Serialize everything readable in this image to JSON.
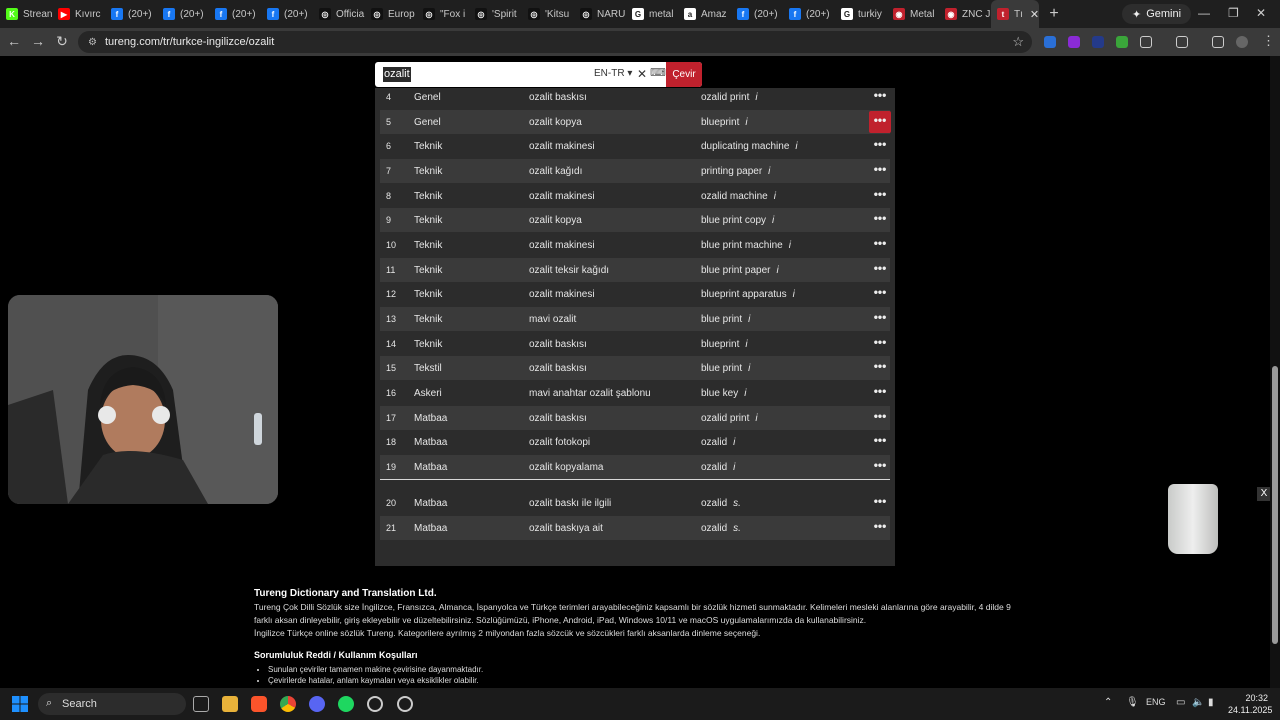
{
  "tabs": [
    {
      "label": "Strean",
      "color": "#53fc18",
      "glyph": "K"
    },
    {
      "label": "Kıvırc",
      "color": "#ff0000",
      "glyph": "▶"
    },
    {
      "label": "(20+)",
      "color": "#1877f2",
      "glyph": "f"
    },
    {
      "label": "(20+)",
      "color": "#1877f2",
      "glyph": "f"
    },
    {
      "label": "(20+)",
      "color": "#1877f2",
      "glyph": "f"
    },
    {
      "label": "(20+)",
      "color": "#1877f2",
      "glyph": "f"
    },
    {
      "label": "Officia",
      "color": "#111111",
      "glyph": "◎"
    },
    {
      "label": "Europ",
      "color": "#111111",
      "glyph": "◎"
    },
    {
      "label": "\"Fox i",
      "color": "#111111",
      "glyph": "◎"
    },
    {
      "label": "'Spirit",
      "color": "#111111",
      "glyph": "◎"
    },
    {
      "label": "'Kitsu",
      "color": "#111111",
      "glyph": "◎"
    },
    {
      "label": "NARU",
      "color": "#111111",
      "glyph": "◎"
    },
    {
      "label": "metal",
      "color": "#ffffff",
      "glyph": "G"
    },
    {
      "label": "Amaz",
      "color": "#ffffff",
      "glyph": "a"
    },
    {
      "label": "(20+)",
      "color": "#1877f2",
      "glyph": "f"
    },
    {
      "label": "(20+)",
      "color": "#1877f2",
      "glyph": "f"
    },
    {
      "label": "turkiy",
      "color": "#ffffff",
      "glyph": "G"
    },
    {
      "label": "Metal",
      "color": "#c0212d",
      "glyph": "◉"
    },
    {
      "label": "ZNC J",
      "color": "#c0212d",
      "glyph": "◉"
    },
    {
      "label": "Tı",
      "color": "#c0212d",
      "glyph": "t"
    }
  ],
  "browser": {
    "gemini_label": "Gemini",
    "url": "tureng.com/tr/turkce-ingilizce/ozalit"
  },
  "search": {
    "value": "ozalit",
    "lang": "EN-TR",
    "button": "Çevir"
  },
  "results": [
    {
      "num": "4",
      "cat": "Genel",
      "tr": "ozalit baskısı",
      "en": "ozalid print",
      "mark": "i"
    },
    {
      "num": "5",
      "cat": "Genel",
      "tr": "ozalit kopya",
      "en": "blueprint",
      "mark": "i"
    },
    {
      "num": "6",
      "cat": "Teknik",
      "tr": "ozalit makinesi",
      "en": "duplicating machine",
      "mark": "i"
    },
    {
      "num": "7",
      "cat": "Teknik",
      "tr": "ozalit kağıdı",
      "en": "printing paper",
      "mark": "i"
    },
    {
      "num": "8",
      "cat": "Teknik",
      "tr": "ozalit makinesi",
      "en": "ozalid machine",
      "mark": "i"
    },
    {
      "num": "9",
      "cat": "Teknik",
      "tr": "ozalit kopya",
      "en": "blue print copy",
      "mark": "i"
    },
    {
      "num": "10",
      "cat": "Teknik",
      "tr": "ozalit makinesi",
      "en": "blue print machine",
      "mark": "i"
    },
    {
      "num": "11",
      "cat": "Teknik",
      "tr": "ozalit teksir kağıdı",
      "en": "blue print paper",
      "mark": "i"
    },
    {
      "num": "12",
      "cat": "Teknik",
      "tr": "ozalit makinesi",
      "en": "blueprint apparatus",
      "mark": "i"
    },
    {
      "num": "13",
      "cat": "Teknik",
      "tr": "mavi ozalit",
      "en": "blue print",
      "mark": "i"
    },
    {
      "num": "14",
      "cat": "Teknik",
      "tr": "ozalit baskısı",
      "en": "blueprint",
      "mark": "i"
    },
    {
      "num": "15",
      "cat": "Tekstil",
      "tr": "ozalit baskısı",
      "en": "blue print",
      "mark": "i"
    },
    {
      "num": "16",
      "cat": "Askeri",
      "tr": "mavi anahtar ozalit şablonu",
      "en": "blue key",
      "mark": "i"
    },
    {
      "num": "17",
      "cat": "Matbaa",
      "tr": "ozalit baskısı",
      "en": "ozalid print",
      "mark": "i"
    },
    {
      "num": "18",
      "cat": "Matbaa",
      "tr": "ozalit fotokopi",
      "en": "ozalid",
      "mark": "i"
    },
    {
      "num": "19",
      "cat": "Matbaa",
      "tr": "ozalit kopyalama",
      "en": "ozalid",
      "mark": "i"
    },
    {
      "num": "20",
      "cat": "Matbaa",
      "tr": "ozalit baskı ile ilgili",
      "en": "ozalid",
      "mark": "s."
    },
    {
      "num": "21",
      "cat": "Matbaa",
      "tr": "ozalit baskıya ait",
      "en": "ozalid",
      "mark": "s."
    }
  ],
  "more_glyph": "•••",
  "footer": {
    "title": "Tureng Dictionary and Translation Ltd.",
    "p1": "Tureng Çok Dilli Sözlük size İngilizce, Fransızca, Almanca, İspanyolca ve Türkçe terimleri arayabileceğiniz kapsamlı bir sözlük hizmeti sunmaktadır. Kelimeleri mesleki alanlarına göre arayabilir, 4 dilde 9 farklı aksan dinleyebilir, giriş ekleyebilir ve düzeltebilirsiniz. Sözlüğümüzü, iPhone, Android, iPad, Windows 10/11 ve macOS uygulamalarımızda da kullanabilirsiniz.",
    "p2": "İngilizce Türkçe online sözlük Tureng. Kategorilere ayrılmış 2 milyondan fazla sözcük ve sözcükleri farklı aksanlarda dinleme seçeneği.",
    "disclaimer_title": "Sorumluluk Reddi / Kullanım Koşulları",
    "items": [
      "Sunulan çeviriler tamamen makine çevirisine dayanmaktadır.",
      "Çevirilerde hatalar, anlam kaymaları veya eksiklikler olabilir."
    ]
  },
  "taskbar": {
    "search": "Search",
    "lang": "ENG",
    "time": "20:32",
    "date": "24.11.2025"
  }
}
